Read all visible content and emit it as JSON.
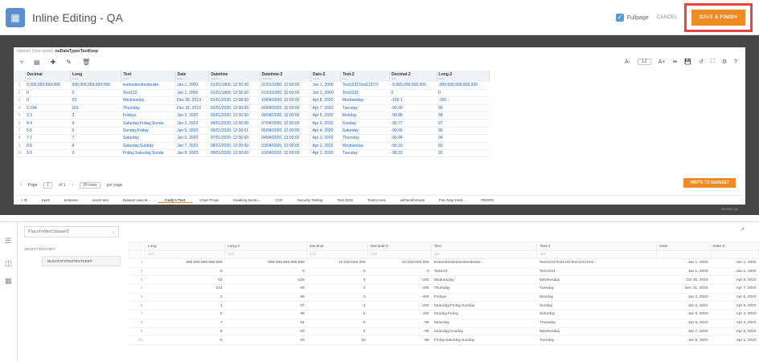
{
  "header": {
    "title": "Inline Editing - QA",
    "fullpage_label": "Fullpage",
    "cancel_label": "CANCEL",
    "save_label": "SAVE & FINISH"
  },
  "editor": {
    "dataset_prefix": "Dataset (Non-spark):",
    "dataset_name": "nuDataTypesTestKeep",
    "zoom_value": "12",
    "columns": [
      {
        "name": "Decimal",
        "type": "NaN"
      },
      {
        "name": "Long",
        "type": "string"
      },
      {
        "name": "Text",
        "type": "text/s"
      },
      {
        "name": "Date",
        "type": "date/s"
      },
      {
        "name": "Datetime",
        "type": "date/time"
      },
      {
        "name": "Datetime-2",
        "type": "date/time"
      },
      {
        "name": "Date-2",
        "type": "date/s"
      },
      {
        "name": "Text-2",
        "type": "abc"
      },
      {
        "name": "Decimal-2",
        "type": "NaN"
      },
      {
        "name": "Long-2",
        "type": "string"
      }
    ],
    "rows": [
      [
        "1",
        "9,999,999,999,999",
        "999,999,999,999,999",
        "testtesttesttesttestte",
        "Jan 1, 2000",
        "01/01/1900, 12:00:00",
        "01/01/1900, 12:00:00",
        "Jan 1, 2000",
        "Test1231Test1231Tr",
        "-9,999,999,999,999",
        "-999,999,999,999,999"
      ],
      [
        "2",
        "0",
        "0",
        "Test123",
        "Jan 1, 2000",
        "01/01/1900, 12:00:00",
        "01/01/1900, 12:00:00",
        "Jan 1, 2000",
        "Test1231",
        "0",
        "0"
      ],
      [
        "3",
        "0",
        "53",
        "Wednesday",
        "Dec 30, 2019",
        "01/01/2020, 12:00:00",
        "10/04/2020, 12:00:00",
        "Apr 8, 2020",
        "Wednesday",
        "-100.1",
        "-100"
      ],
      [
        "4",
        "2.234",
        "101",
        "Thursday",
        "Dec 31, 2019",
        "02/01/2020, 12:00:00",
        "09/04/2020, 12:00:00",
        "Apr 7, 2020",
        "Tuesday",
        "-99.99",
        "99"
      ],
      [
        "5",
        "3.3",
        "3",
        "Fridays",
        "Jan 3, 2020",
        "03/01/2020, 12:00:00",
        "08/04/2020, 12:00:00",
        "Apr 6, 2020",
        "Monday",
        "-99.88",
        "98"
      ],
      [
        "6",
        "4.4",
        "4",
        "Saturday,Friday,Sunda",
        "Jan 2, 2022",
        "04/01/2020, 12:00:00",
        "07/04/2020, 12:00:00",
        "Apr 9, 2020",
        "Sunday",
        "-99.77",
        "97"
      ],
      [
        "7",
        "5.5",
        "5",
        "Sunday,Friday",
        "Jan 5, 2020",
        "05/01/2020, 12:00:01",
        "06/04/2020, 12:00:00",
        "Apr 4, 2020",
        "Saturday",
        "-99.66",
        "96"
      ],
      [
        "8",
        "7.7",
        "7",
        "Saturday",
        "Jan 6, 2020",
        "07/01/2020, 12:00:00",
        "04/04/2020, 13:00:00",
        "Apr 3, 2020",
        "Thursday",
        "-99.44",
        "94"
      ],
      [
        "9",
        "8.8",
        "8",
        "Saturday,Sunday",
        "Jan 7, 2020",
        "08/01/2020, 12:00:00",
        "03/04/2020, 12:00:00",
        "Apr 2, 2020",
        "Wednesday",
        "-99.33",
        "93"
      ],
      [
        "10",
        "9.9",
        "9",
        "Friday,Saturday,Sunda",
        "Jan 8, 2020",
        "09/01/2020, 12:00:00",
        "02/04/2020, 12:00:00",
        "Apr 1, 2020",
        "Tuesday",
        "-99.22",
        "92"
      ]
    ],
    "pager": {
      "page_label": "Page",
      "page": "1",
      "of_label": "of 1",
      "rows_label": "25 rows",
      "per_page": "per page"
    },
    "write_label": "WRITE TO DATASET",
    "tabs": [
      "eye3",
      "testeeee",
      "anom test",
      "Dataset view te...",
      "Cody's Test",
      "Chart Props",
      "breaking backu...",
      "CCF",
      "Security Testing",
      "Test 3232",
      "TestAccess",
      "withtestformula",
      "Flex Map Heat ...",
      "PEDRO"
    ],
    "active_tab": "Cody's Test",
    "env_label": "PILPEE-QA"
  },
  "bottom": {
    "placeholder_label": "PlaceholderDataset1",
    "select_dataset_label": "SELECT DATASET",
    "dataset_item": "NUDATATYPESTESTKEEP",
    "headers": [
      "Long",
      "Long-2",
      "Decimal",
      "Decimal-2",
      "Text",
      "Text-2",
      "Date",
      "Date-2"
    ],
    "filter_hints": [
      "123",
      "123",
      "123",
      "123",
      "abc",
      "abc",
      "",
      ""
    ],
    "rows": [
      [
        "1",
        "999,999,999,999,999",
        "-999,999,999,999,999",
        "10,000,000,000",
        "-10,000,000,000",
        "testtesttesttesttesttesttestte...",
        "Test1231Test1231Test1231Test...",
        "Jan 1, 2000",
        "Jan 1, 2000"
      ],
      [
        "2",
        "0",
        "0",
        "0",
        "0",
        "Test123",
        "Test1231",
        "Jan 1, 2000",
        "Jan 1, 2000"
      ],
      [
        "3",
        "53",
        "-100",
        "0",
        "-100",
        "Wednesday",
        "Wednesday",
        "Oct 30, 2019",
        "Apr 8, 2020"
      ],
      [
        "4",
        "101",
        "99",
        "2",
        "-100",
        "Thursday",
        "Tuesday",
        "Dec 31, 2019",
        "Apr 7, 2020"
      ],
      [
        "5",
        "3",
        "98",
        "3",
        "-100",
        "Fridays",
        "Monday",
        "Jan 3, 2020",
        "Apr 6, 2020"
      ],
      [
        "6",
        "4",
        "97",
        "4",
        "-100",
        "Saturday,Friday,Sunday",
        "Sunday",
        "Jan 2, 2022",
        "Apr 5, 2020"
      ],
      [
        "7",
        "5",
        "96",
        "6",
        "-100",
        "Sunday,Friday",
        "Saturday",
        "Jan 5, 2020",
        "Apr 4, 2020"
      ],
      [
        "8",
        "7",
        "94",
        "8",
        "-99",
        "Saturday",
        "Thursday",
        "Jan 6, 2020",
        "Apr 3, 2020"
      ],
      [
        "9",
        "8",
        "93",
        "9",
        "-99",
        "Saturday,Sunday",
        "Wednesday",
        "Jan 7, 2020",
        "Apr 2, 2020"
      ],
      [
        "10",
        "9",
        "92",
        "10",
        "-99",
        "Friday,Saturday,Sunday",
        "Tuesday",
        "Jan 8, 2020",
        "Apr 1, 2020"
      ]
    ]
  },
  "colors": {
    "accent": "#f08a24",
    "highlight": "#e8453c",
    "link": "#1a63c8"
  }
}
